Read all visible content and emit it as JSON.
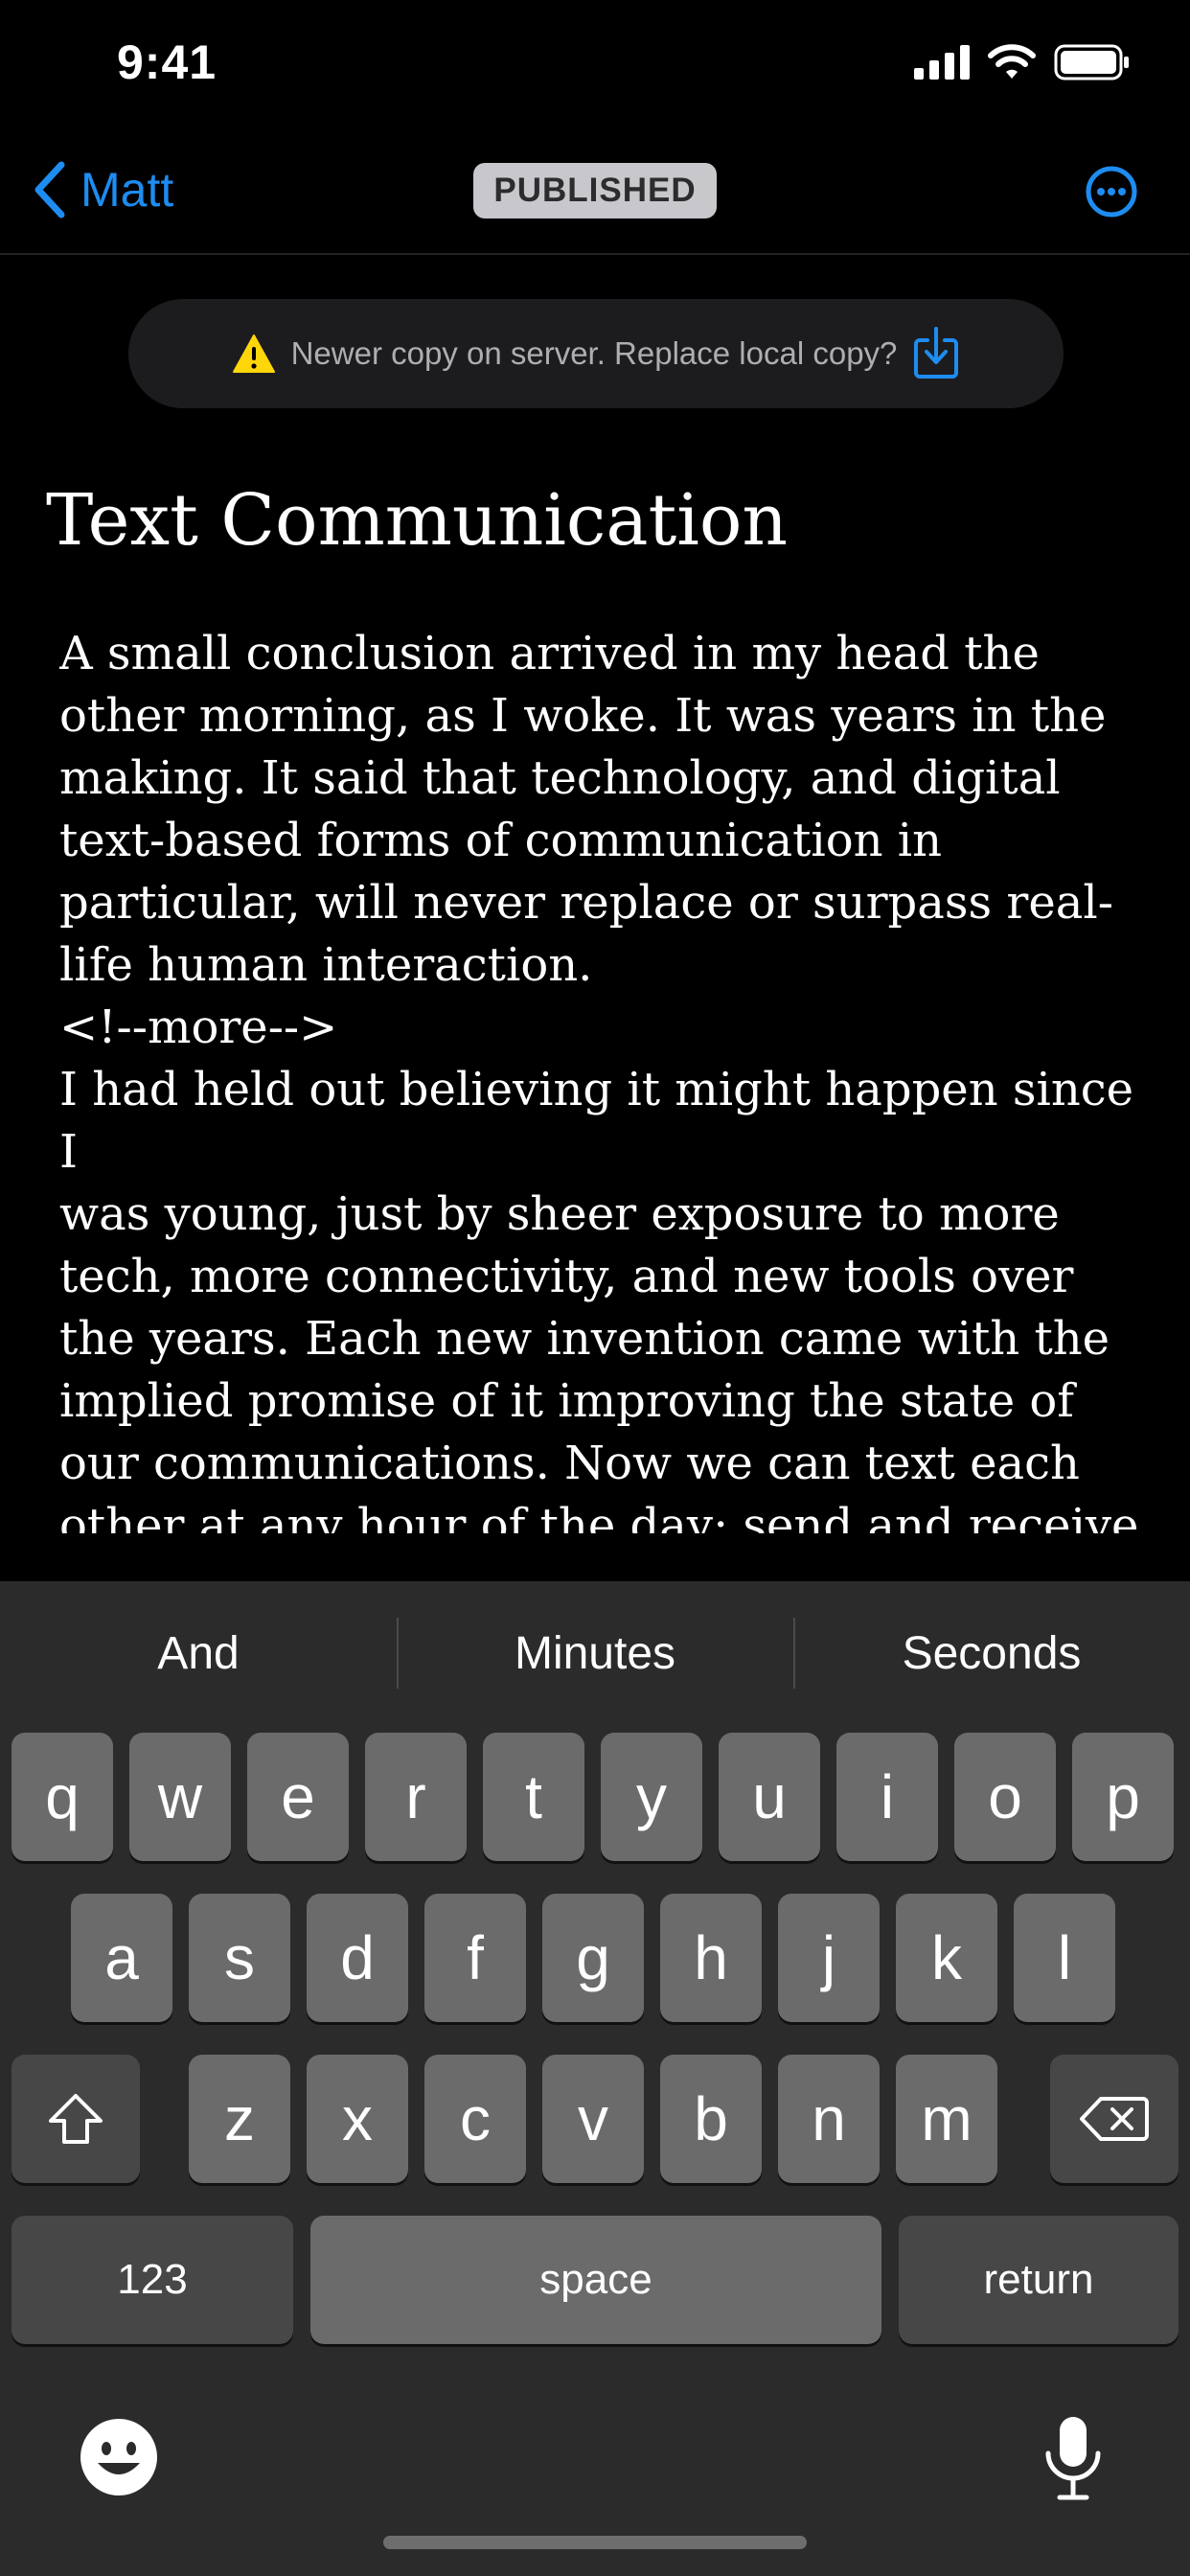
{
  "status_bar": {
    "time": "9:41"
  },
  "nav": {
    "back_label": "Matt",
    "status_badge": "PUBLISHED"
  },
  "banner": {
    "text": "Newer copy on server. Replace local copy?"
  },
  "document": {
    "title": "Text Communication",
    "body": "A small conclusion arrived in my head the\nother morning, as I woke. It was years in the\nmaking. It said that technology, and digital\ntext-based forms of communication in\nparticular, will never replace or surpass real-\nlife human interaction.\n<!--more-->\nI had held out believing it might happen since I\nwas young, just by sheer exposure to more\ntech, more connectivity, and new tools over\nthe years. Each new invention came with the\nimplied promise of it improving the state of\nour communications. Now we can text each\nother at any hour of the day; send and receive\nmessages anywhere we are. We'll never need"
  },
  "keyboard": {
    "suggestions": [
      "And",
      "Minutes",
      "Seconds"
    ],
    "row1": [
      "q",
      "w",
      "e",
      "r",
      "t",
      "y",
      "u",
      "i",
      "o",
      "p"
    ],
    "row2": [
      "a",
      "s",
      "d",
      "f",
      "g",
      "h",
      "j",
      "k",
      "l"
    ],
    "row3": [
      "z",
      "x",
      "c",
      "v",
      "b",
      "n",
      "m"
    ],
    "numbers_label": "123",
    "space_label": "space",
    "return_label": "return"
  },
  "colors": {
    "accent": "#1e8cf0",
    "warning": "#ffd60a",
    "badge_bg": "#c7c7cc"
  }
}
